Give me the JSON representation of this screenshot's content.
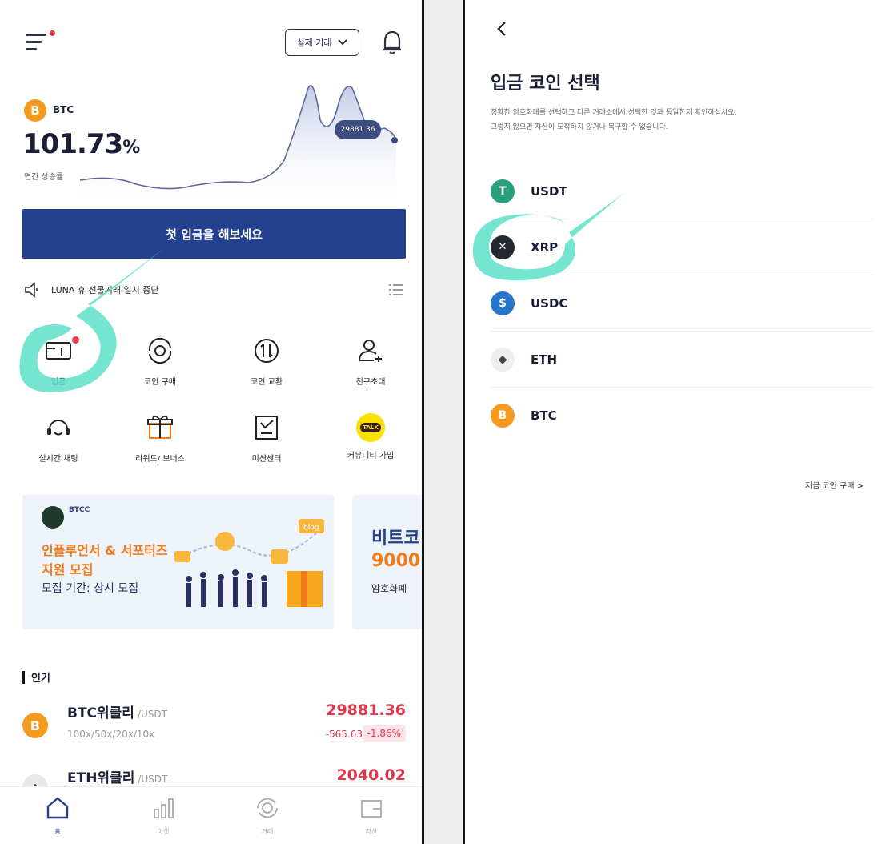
{
  "colors": {
    "primary": "#23418f",
    "accent_orange": "#f39a1f",
    "price_red": "#e0394d",
    "highlight_teal": "#5be0c8"
  },
  "left": {
    "header": {
      "menu_icon": "hamburger-icon",
      "mode_label": "실제 거래",
      "bell_icon": "bell-icon"
    },
    "hero": {
      "coin": "BTC",
      "coin_glyph": "B",
      "percent": "101.73",
      "percent_unit": "%",
      "subtitle": "연간 상승률",
      "price_tag": "29881.36"
    },
    "cta_label": "첫 입금을 해보세요",
    "notice": {
      "text": "LUNA 휴     선물거래 일시 중단"
    },
    "grid": [
      {
        "label": "입금",
        "icon": "deposit-icon"
      },
      {
        "label": "코인 구매",
        "icon": "coin-buy-icon"
      },
      {
        "label": "코인 교환",
        "icon": "coin-swap-icon"
      },
      {
        "label": "친구초대",
        "icon": "invite-friend-icon"
      },
      {
        "label": "실시간 채팅",
        "icon": "headset-icon"
      },
      {
        "label": "리워드/ 보너스",
        "icon": "gift-icon"
      },
      {
        "label": "미션센터",
        "icon": "mission-icon"
      },
      {
        "label": "커뮤니티 가입",
        "icon": "talk-icon",
        "badge": "TALK"
      }
    ],
    "banner": {
      "brand": "BTCC",
      "line1": "인플루언서 & 서포터즈",
      "line2": "지원 모집",
      "line3": "모집 기간: 상시 모집",
      "blog_tag": "blog"
    },
    "banner2": {
      "line1": "비트코",
      "line2": "9000",
      "line3": "암호화폐"
    },
    "popular_title": "인기",
    "markets": [
      {
        "name": "BTC위클리",
        "quote": "/USDT",
        "leverage": "100x/50x/20x/10x",
        "price": "29881.36",
        "change": "-565.63",
        "change_pct": "-1.86%",
        "glyph": "B"
      },
      {
        "name": "ETH위클리",
        "quote": "/USDT",
        "price": "2040.02"
      }
    ],
    "bottom_nav": [
      {
        "label": "홈",
        "icon": "home-icon",
        "active": true
      },
      {
        "label": "마켓",
        "icon": "market-icon"
      },
      {
        "label": "거래",
        "icon": "trade-icon"
      },
      {
        "label": "자산",
        "icon": "wallet-icon"
      }
    ]
  },
  "right": {
    "back_icon": "chevron-left-icon",
    "title": "입금 코인 선택",
    "desc_line1": "정확한 암호화폐를 선택하고 다른 거래소에서 선택한 것과 동일한지 확인하십시오.",
    "desc_line2": "그렇지 않으면 자산이 도착하지 않거나 복구할 수 없습니다.",
    "coins": [
      {
        "symbol": "USDT",
        "glyph": "T",
        "color": "#26a17b"
      },
      {
        "symbol": "XRP",
        "glyph": "✕",
        "color": "#23292f"
      },
      {
        "symbol": "USDC",
        "glyph": "$",
        "color": "#2775ca"
      },
      {
        "symbol": "ETH",
        "glyph": "◆",
        "color": "#eeeeee"
      },
      {
        "symbol": "BTC",
        "glyph": "B",
        "color": "#f39a1f"
      }
    ],
    "buy_link": "지금 코인 구매 >"
  }
}
